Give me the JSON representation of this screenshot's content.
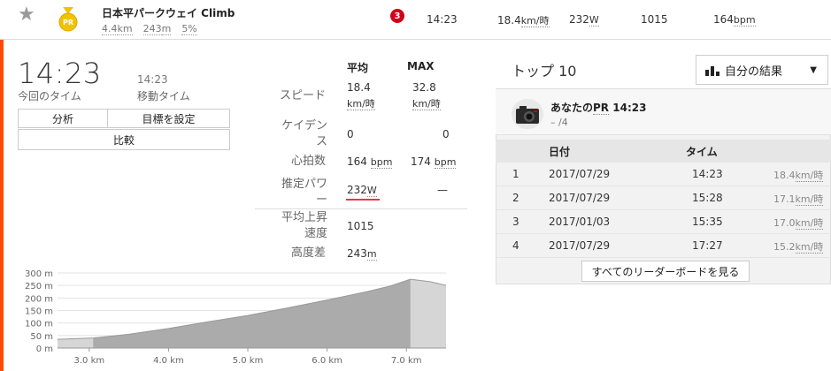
{
  "segment": {
    "name": "日本平パークウェイ Climb",
    "distance": "4.4",
    "distance_unit": "km",
    "elev_gain": "243",
    "elev_unit": "m",
    "grade": "5%",
    "rank_badge": "3",
    "time": "14:23",
    "speed": "18.4",
    "speed_unit": "km/時",
    "power": "232",
    "power_unit": "W",
    "vam": "1015",
    "heart_rate": "164",
    "hr_unit": "bpm",
    "medal_text": "PR"
  },
  "summary": {
    "time": "14:23",
    "time_label": "今回のタイム",
    "moving_time": "14:23",
    "moving_label": "移動タイム",
    "btn_analysis": "分析",
    "btn_goal": "目標を設定",
    "btn_compare": "比較"
  },
  "stats": {
    "head_avg": "平均",
    "head_max": "MAX",
    "rows": [
      {
        "label": "スピード",
        "avg": "18.4",
        "avg_unit": "km/時",
        "max": "32.8",
        "max_unit": "km/時"
      },
      {
        "label": "ケイデンス",
        "avg": "0",
        "max": "0"
      },
      {
        "label": "心拍数",
        "avg": "164",
        "avg_unit": "bpm",
        "max": "174",
        "max_unit": "bpm"
      },
      {
        "label": "推定パワー",
        "avg": "232",
        "avg_unit": "W",
        "max": "—"
      }
    ],
    "vam_label": "平均上昇速度",
    "vam": "1015",
    "elev_label": "高度差",
    "elev": "243",
    "elev_unit": "m"
  },
  "chart_data": {
    "type": "area",
    "y_ticks": [
      "300 m",
      "250 m",
      "200 m",
      "150 m",
      "100 m",
      "50 m",
      "0 m"
    ],
    "x_ticks": [
      "3.0 km",
      "4.0 km",
      "5.0 km",
      "6.0 km",
      "7.0 km"
    ],
    "ylim": [
      0,
      300
    ],
    "xlim": [
      2.6,
      7.5
    ],
    "highlight_range": [
      3.05,
      7.05
    ],
    "x": [
      2.6,
      3.05,
      3.5,
      4.0,
      4.5,
      5.0,
      5.5,
      6.0,
      6.5,
      6.8,
      7.05,
      7.3,
      7.5
    ],
    "y": [
      35,
      40,
      55,
      78,
      105,
      130,
      160,
      192,
      225,
      248,
      275,
      265,
      250
    ]
  },
  "top10": {
    "title": "トップ 10",
    "dropdown": "自分の結果",
    "pr_title_prefix": "あなたの",
    "pr_title_pr": "PR",
    "pr_title_time": "14:23",
    "pr_sub": "– /4",
    "col_date": "日付",
    "col_time": "タイム",
    "rows": [
      {
        "rank": "1",
        "date": "2017/07/29",
        "time": "14:23",
        "speed": "18.4",
        "unit": "km/時"
      },
      {
        "rank": "2",
        "date": "2017/07/29",
        "time": "15:28",
        "speed": "17.1",
        "unit": "km/時"
      },
      {
        "rank": "3",
        "date": "2017/01/03",
        "time": "15:35",
        "speed": "17.0",
        "unit": "km/時"
      },
      {
        "rank": "4",
        "date": "2017/07/29",
        "time": "17:27",
        "speed": "15.2",
        "unit": "km/時"
      }
    ],
    "see_all": "すべてのリーダーボードを見る"
  }
}
